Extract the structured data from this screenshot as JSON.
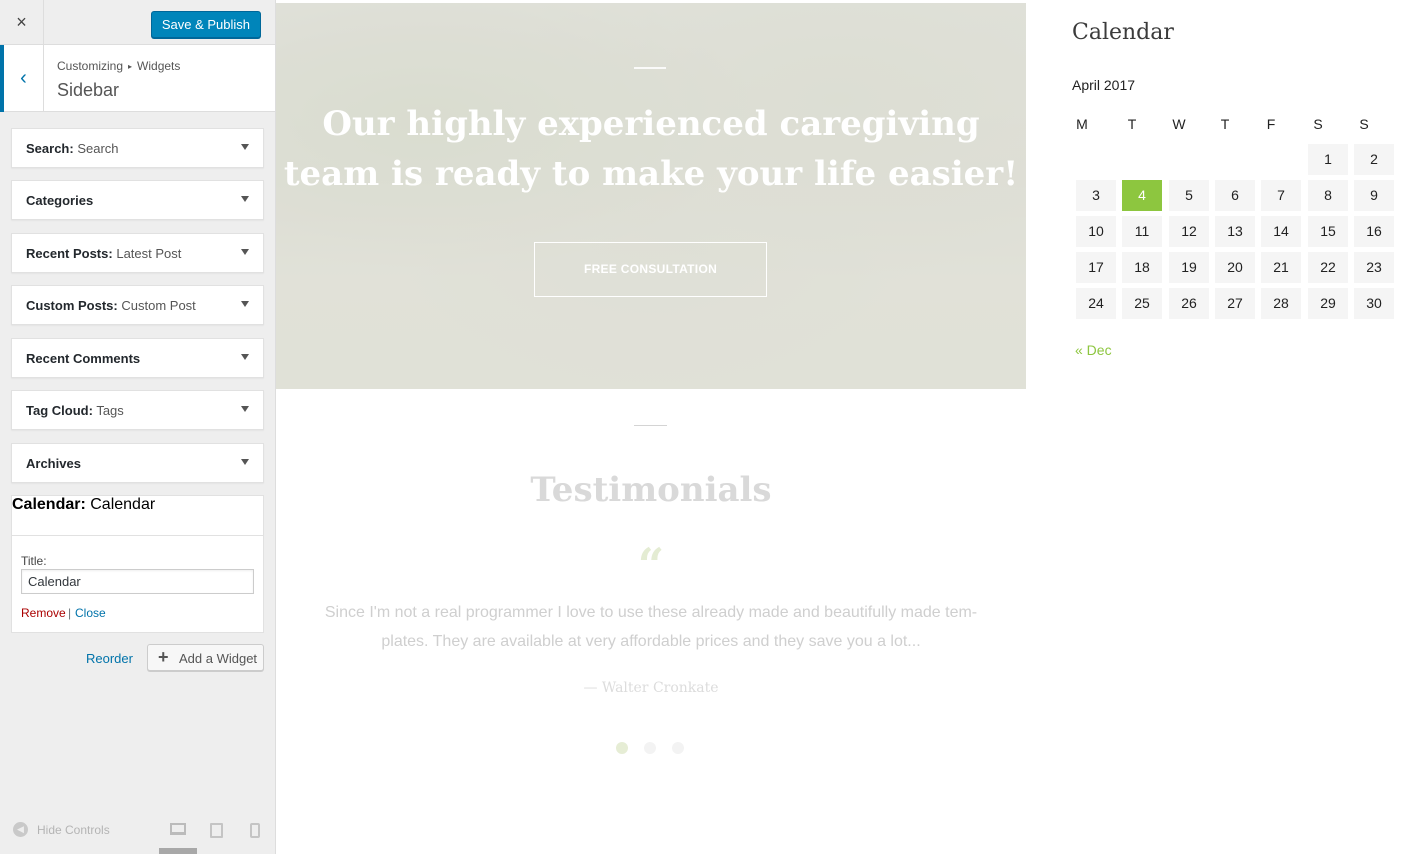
{
  "customizer": {
    "close_label": "×",
    "publish_label": "Save & Publish",
    "breadcrumb": {
      "root": "Customizing",
      "separator": "▸",
      "section": "Widgets"
    },
    "section_title": "Sidebar",
    "back_label": "‹",
    "widgets": [
      {
        "name": "Search",
        "subtitle": "Search"
      },
      {
        "name": "Categories",
        "subtitle": ""
      },
      {
        "name": "Recent Posts",
        "subtitle": "Latest Post"
      },
      {
        "name": "Custom Posts",
        "subtitle": "Custom Post"
      },
      {
        "name": "Recent Comments",
        "subtitle": ""
      },
      {
        "name": "Tag Cloud",
        "subtitle": "Tags"
      },
      {
        "name": "Archives",
        "subtitle": ""
      },
      {
        "name": "Calendar",
        "subtitle": "Calendar"
      }
    ],
    "expanded_widget": {
      "title_label": "Title:",
      "title_value": "Calendar",
      "remove_label": "Remove",
      "separator": "|",
      "close_label": "Close"
    },
    "reorder_label": "Reorder",
    "add_widget_label": "Add a Widget",
    "hide_controls_label": "Hide Controls"
  },
  "preview": {
    "hero": {
      "line1": "Our highly experienced caregiving",
      "line2": "team is ready to make your life easier!",
      "button_label": "FREE CONSULTATION"
    },
    "testimonials": {
      "title": "Testimonials",
      "quote_mark": "“",
      "text_line1": "Since I'm not a real programmer I love to use these already made and beautifully made tem-",
      "text_line2": "plates. They are available at very affordable prices and they save you a lot...",
      "author": "— Walter Cronkate",
      "dots": 3,
      "active_dot": 0
    },
    "calendar": {
      "title": "Calendar",
      "caption": "April 2017",
      "weekdays": [
        "M",
        "T",
        "W",
        "T",
        "F",
        "S",
        "S"
      ],
      "weeks": [
        [
          "",
          "",
          "",
          "",
          "",
          "1",
          "2"
        ],
        [
          "3",
          "4",
          "5",
          "6",
          "7",
          "8",
          "9"
        ],
        [
          "10",
          "11",
          "12",
          "13",
          "14",
          "15",
          "16"
        ],
        [
          "17",
          "18",
          "19",
          "20",
          "21",
          "22",
          "23"
        ],
        [
          "24",
          "25",
          "26",
          "27",
          "28",
          "29",
          "30"
        ]
      ],
      "today": "4",
      "prev_link": "« Dec",
      "today_color": "#8dc63f"
    }
  }
}
